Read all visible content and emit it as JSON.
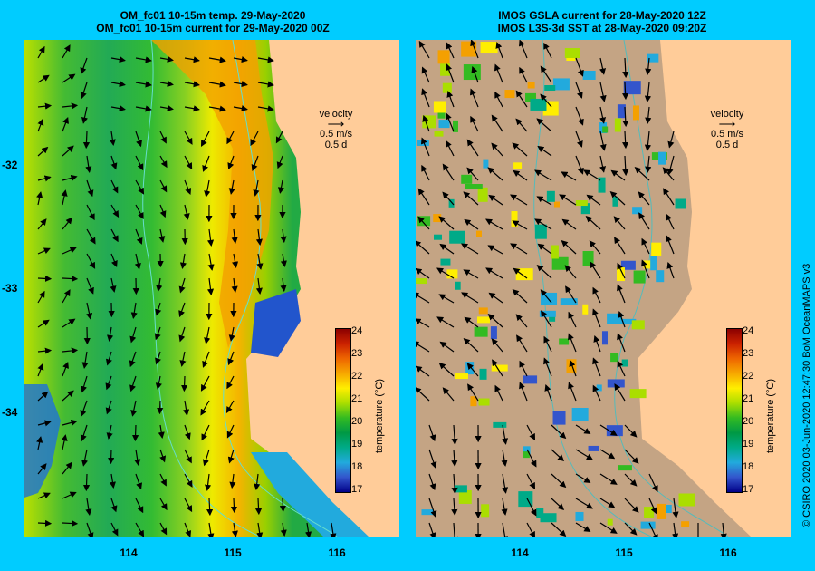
{
  "left_panel": {
    "title_line1": "OM_fc01 10-15m temp. 29-May-2020",
    "title_line2": "OM_fc01 10-15m current for 29-May-2020 00Z",
    "velocity_label": "velocity",
    "velocity_scale": "0.5 m/s",
    "velocity_time": "0.5 d"
  },
  "right_panel": {
    "title_line1": "IMOS GSLA current for 28-May-2020 12Z",
    "title_line2": "IMOS L3S-3d SST at 28-May-2020 09:20Z",
    "velocity_label": "velocity",
    "velocity_scale": "0.5 m/s",
    "velocity_time": "0.5 d"
  },
  "axes": {
    "x_ticks": [
      "114",
      "115",
      "116"
    ],
    "y_ticks": [
      "-32",
      "-33",
      "-34"
    ]
  },
  "colorbar": {
    "title": "temperature (°C)",
    "ticks": [
      "24",
      "23",
      "22",
      "21",
      "20",
      "19",
      "18",
      "17"
    ],
    "colors": [
      "#8b0000",
      "#cc2200",
      "#ee6600",
      "#f7a800",
      "#ffee00",
      "#aade00",
      "#33bb22",
      "#009944",
      "#00aa88",
      "#22aadd",
      "#3355cc",
      "#000088"
    ]
  },
  "credit": "© CSIRO 2020   03-Jun-2020 12:47:30 BoM OceanMAPS v3",
  "colors": {
    "background": "#00ccff",
    "land": "#ffcc99",
    "no_data_sea": "#c4a484"
  }
}
